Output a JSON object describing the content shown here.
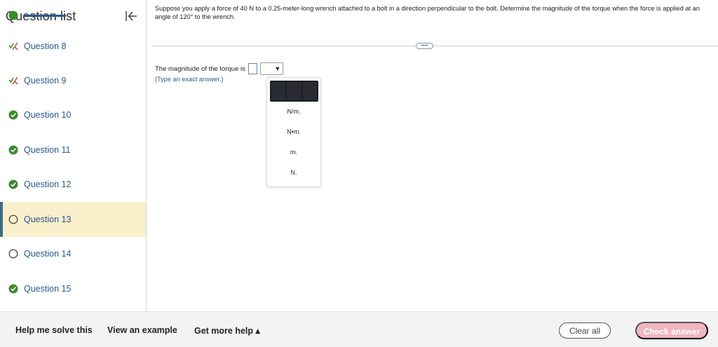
{
  "sidebar": {
    "title": "Question list",
    "items": [
      {
        "label": "Question 8",
        "status": "partial"
      },
      {
        "label": "Question 9",
        "status": "partial"
      },
      {
        "label": "Question 10",
        "status": "correct"
      },
      {
        "label": "Question 11",
        "status": "correct"
      },
      {
        "label": "Question 12",
        "status": "correct"
      },
      {
        "label": "Question 13",
        "status": "current"
      },
      {
        "label": "Question 14",
        "status": "unanswered"
      },
      {
        "label": "Question 15",
        "status": "correct"
      }
    ]
  },
  "question": {
    "text": "Suppose you apply a force of 40 N to a 0.25-meter-long wrench attached to a bolt in a direction perpendicular to the bolt. Determine the magnitude of the torque when the force is applied at an angle of 120° to the wrench.",
    "more_label": "••••"
  },
  "answer": {
    "prefix": "The magnitude of the torque is",
    "input_value": "",
    "hint": "(Type an exact answer.)",
    "dropdown_arrow": "▼",
    "options": [
      "N/m.",
      "N•m.",
      "m.",
      "N."
    ]
  },
  "footer": {
    "help_label": "Help me solve this",
    "example_label": "View an example",
    "more_help_label": "Get more help ▴",
    "clear_label": "Clear all",
    "check_label": "Check answer"
  },
  "colors": {
    "active_bg": "#faf0cc",
    "active_border": "#3d6b86",
    "correct_green": "#3c8a2e",
    "link_blue": "#2a5a8a",
    "check_disabled": "#efb6c0"
  }
}
